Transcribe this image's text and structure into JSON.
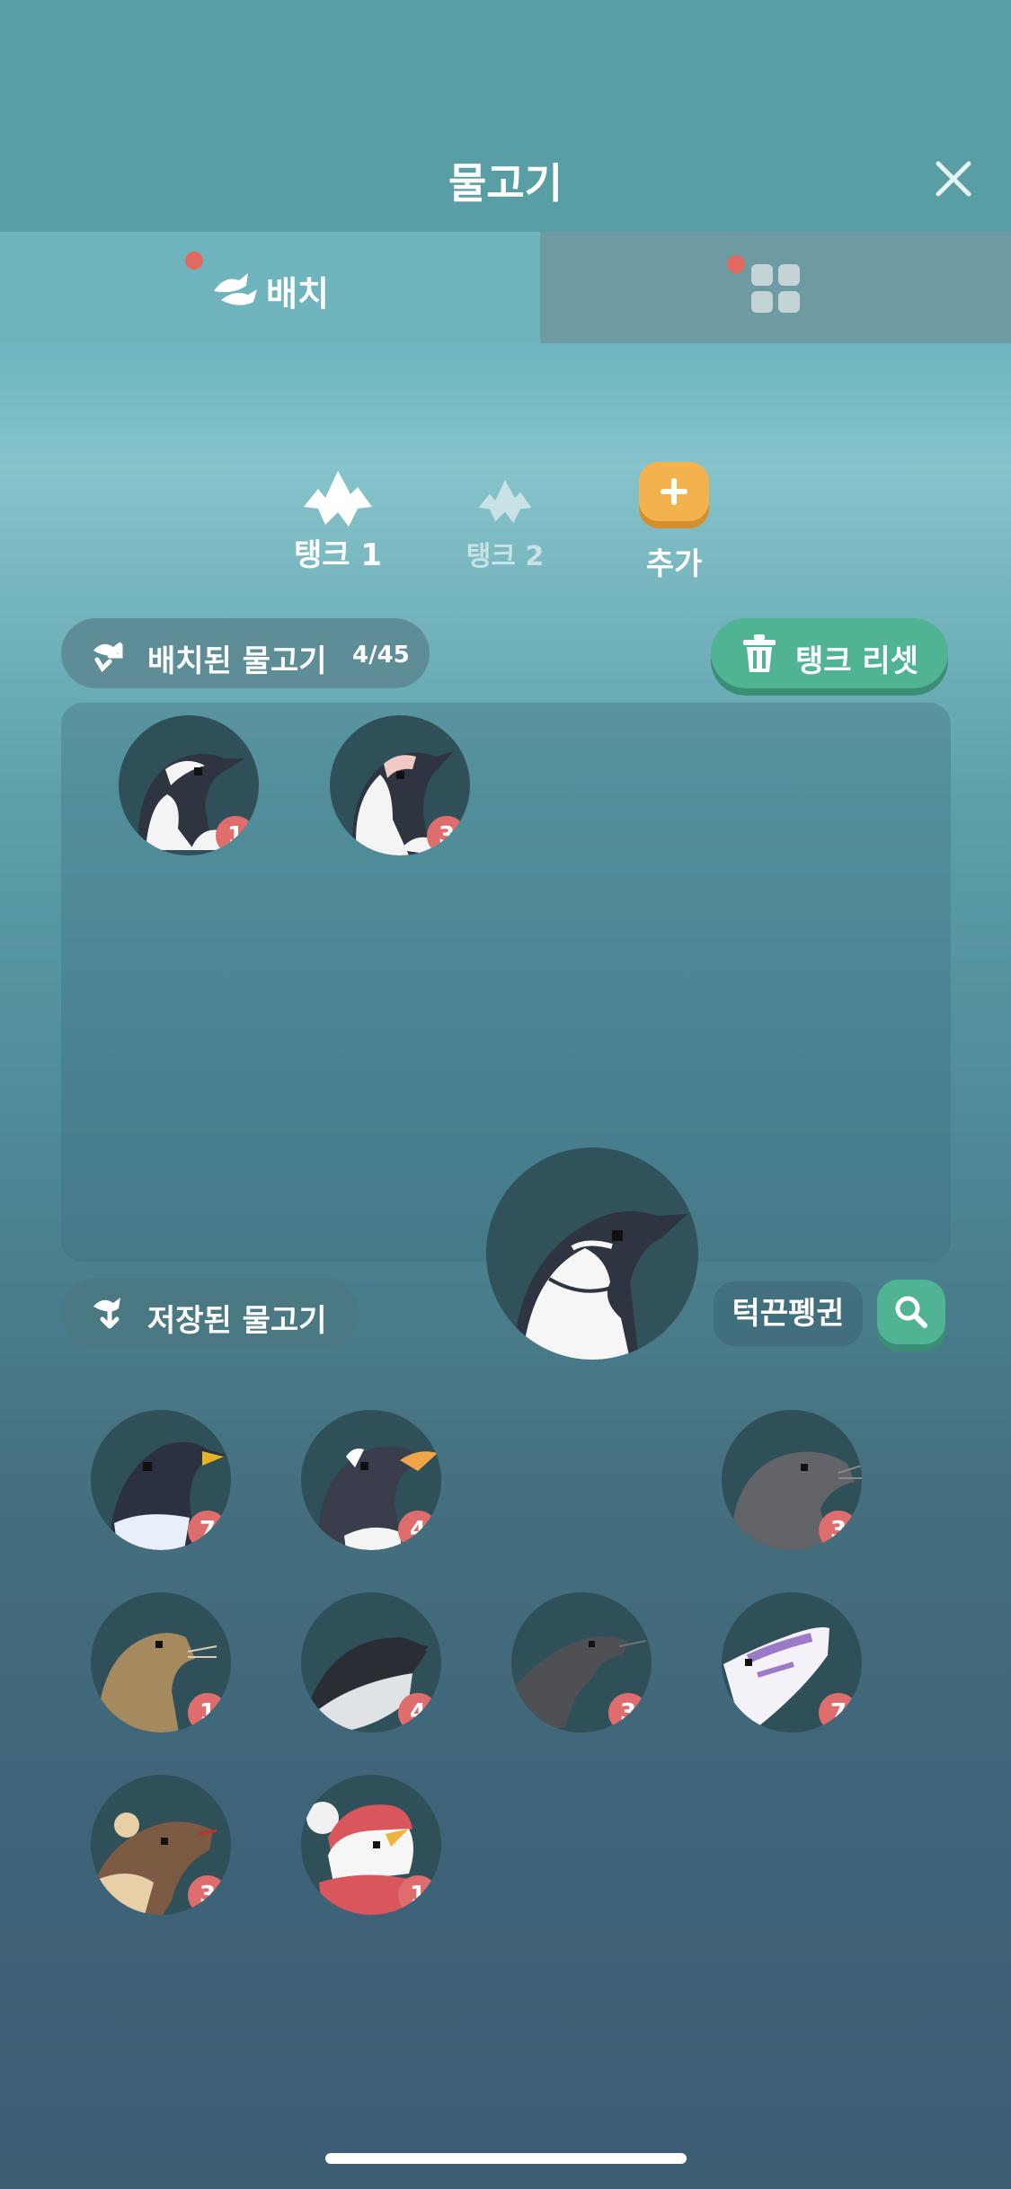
{
  "header": {
    "title": "물고기",
    "close_icon": "close-icon"
  },
  "tabs": [
    {
      "label": "배치",
      "icon": "fish-icon",
      "has_dot": true
    },
    {
      "label": "",
      "icon": "grid-icon",
      "has_dot": true
    }
  ],
  "tanks": [
    {
      "label": "탱크 1",
      "active": true
    },
    {
      "label": "탱크 2",
      "active": false
    },
    {
      "label": "추가",
      "type": "add"
    }
  ],
  "placed_section": {
    "label": "배치된 물고기",
    "count": "4/45"
  },
  "reset_button": {
    "label": "탱크 리셋"
  },
  "placed_items": [
    {
      "animal": "penguin",
      "count": "1"
    },
    {
      "animal": "penguin",
      "count": "3"
    }
  ],
  "saved_section": {
    "label": "저장된 물고기"
  },
  "selected_item": {
    "animal": "chinstrap-penguin",
    "name": "턱끈펭귄"
  },
  "saved_items": [
    {
      "animal": "penguin",
      "count": "7"
    },
    {
      "animal": "penguin",
      "count": "4"
    },
    {
      "animal": "seal",
      "count": "3"
    },
    {
      "animal": "sea-lion",
      "count": "1"
    },
    {
      "animal": "orca",
      "count": "4"
    },
    {
      "animal": "seal",
      "count": "3"
    },
    {
      "animal": "fish",
      "count": "7"
    },
    {
      "animal": "otter",
      "count": "3"
    },
    {
      "animal": "penguin-hat",
      "count": "1"
    }
  ],
  "colors": {
    "accent_green": "#4fb394",
    "badge_red": "#e06d6d",
    "add_orange": "#f3b24d"
  }
}
